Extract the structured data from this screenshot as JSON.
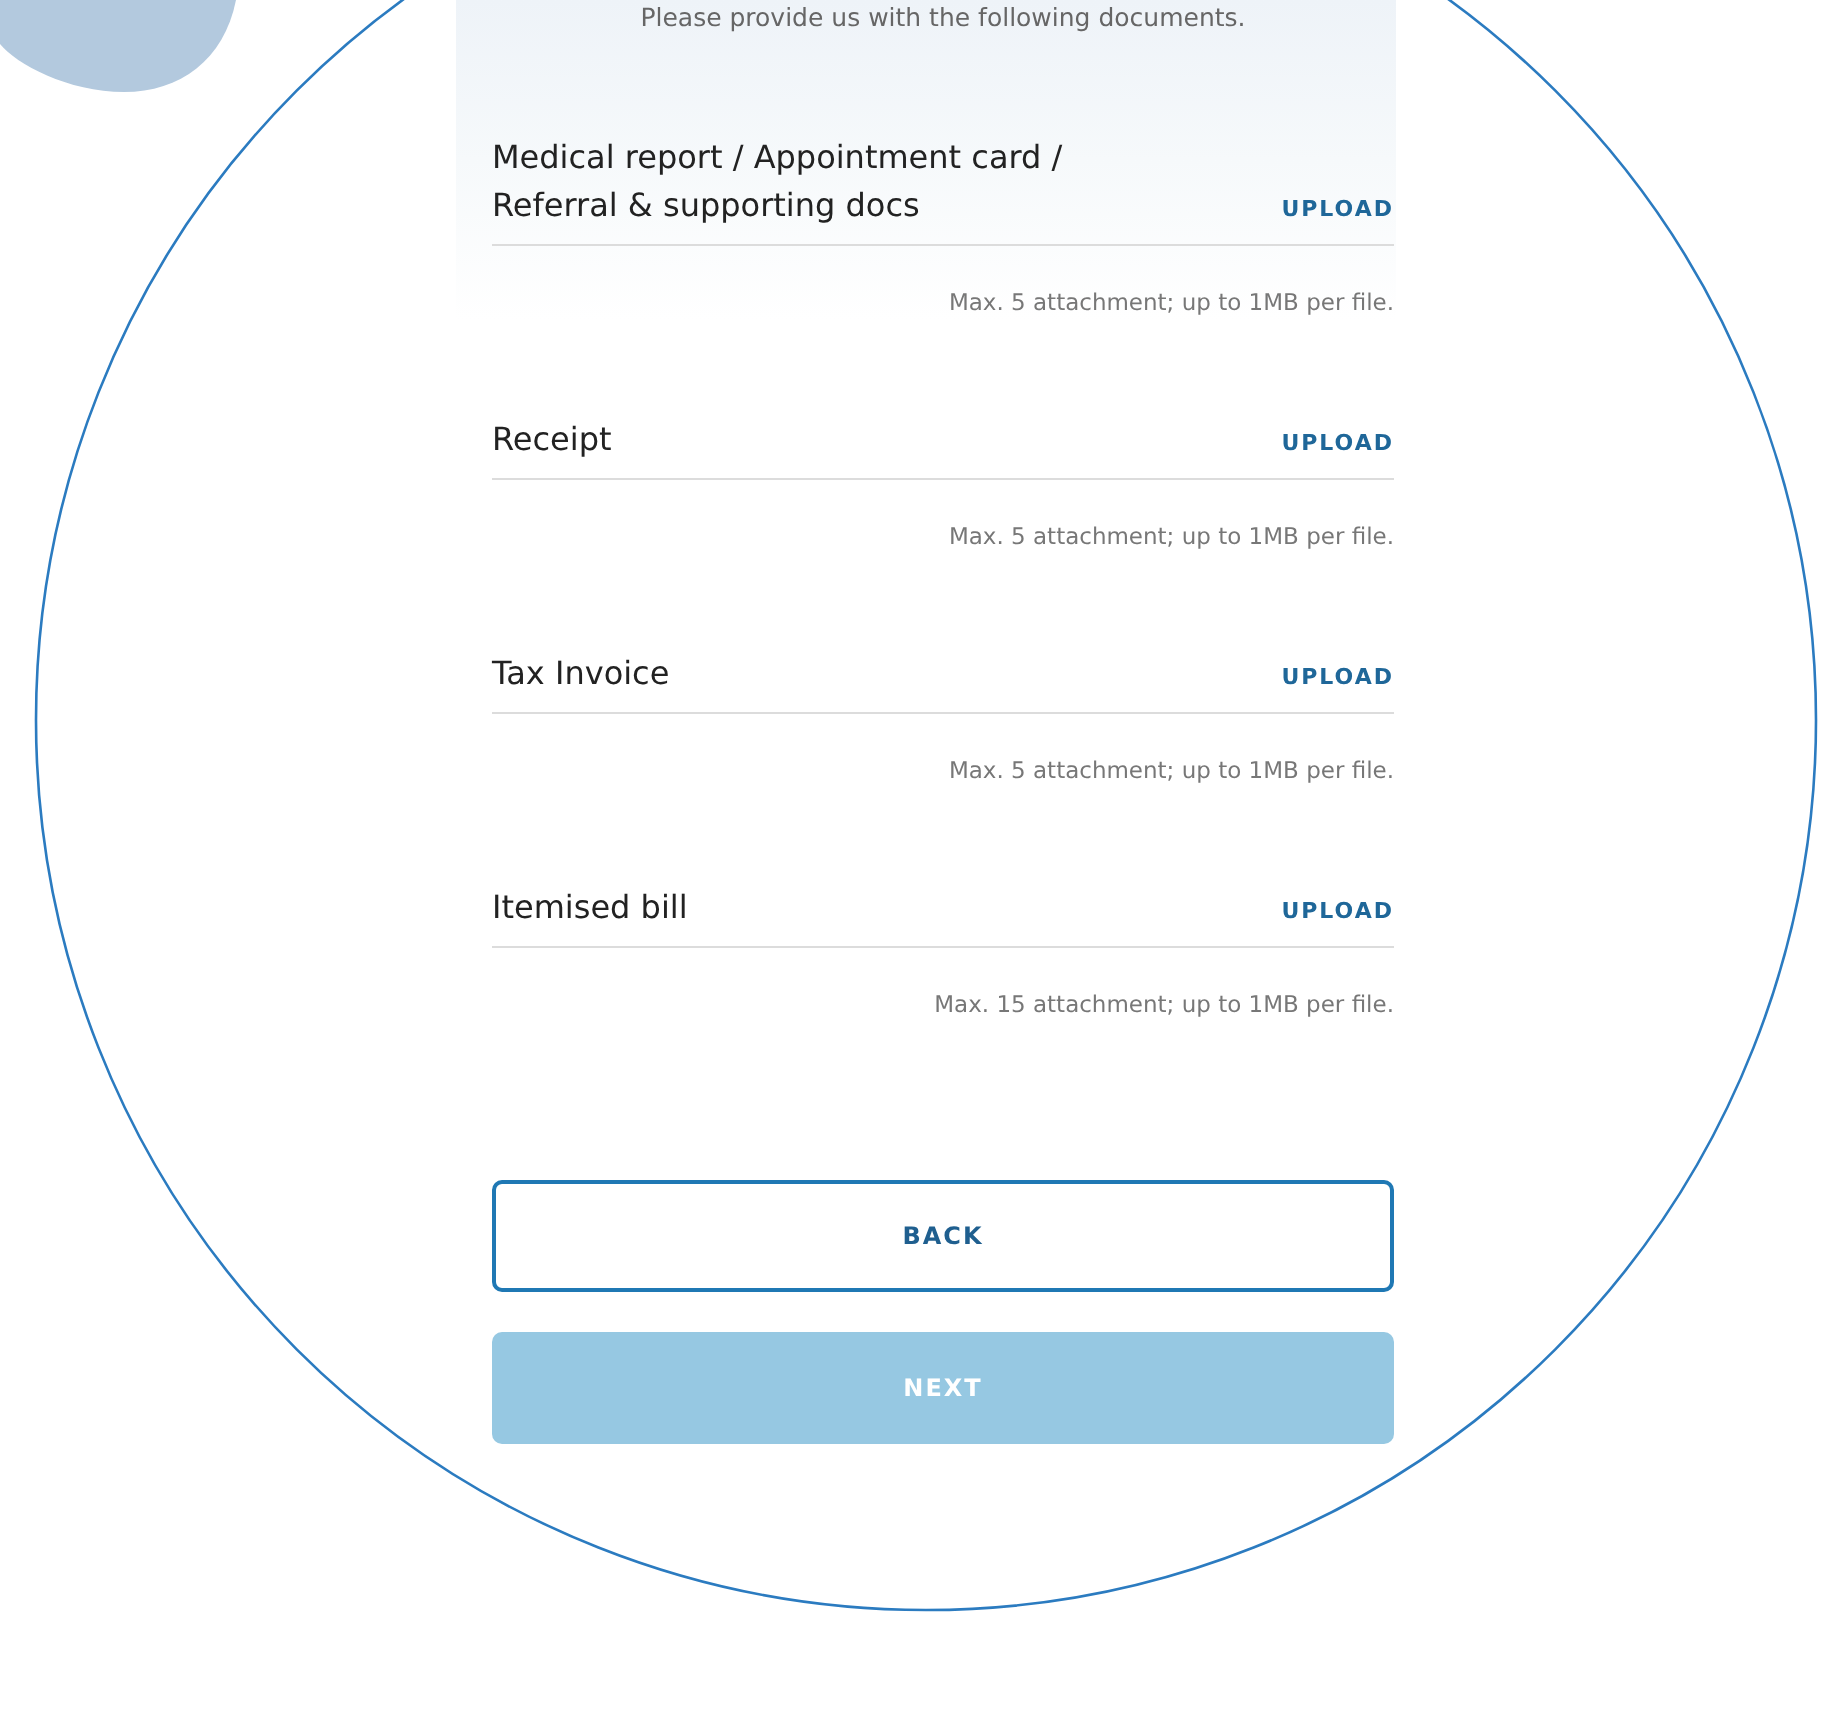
{
  "subtitle": "Please provide us with the following documents.",
  "documents": [
    {
      "label": "Medical report / Appointment card /\nReferral & supporting docs",
      "action": "UPLOAD",
      "hint": "Max. 5 attachment; up to 1MB per file."
    },
    {
      "label": "Receipt",
      "action": "UPLOAD",
      "hint": "Max. 5 attachment; up to 1MB per file."
    },
    {
      "label": "Tax Invoice",
      "action": "UPLOAD",
      "hint": "Max. 5 attachment; up to 1MB per file."
    },
    {
      "label": "Itemised bill",
      "action": "UPLOAD",
      "hint": "Max. 15 attachment; up to 1MB per file."
    }
  ],
  "back_button": {
    "label": "BACK"
  },
  "next_button": {
    "label": "NEXT",
    "disabled": true
  }
}
